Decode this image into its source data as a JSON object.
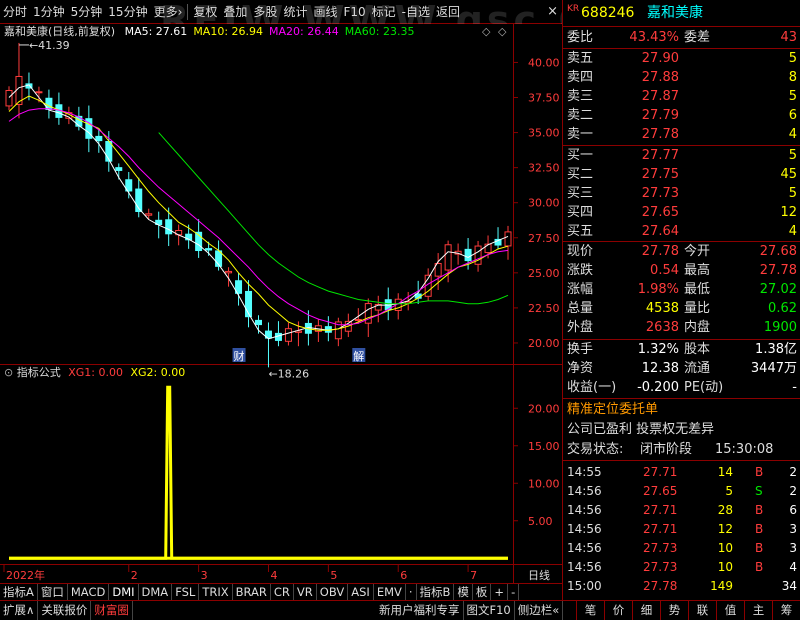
{
  "toolbar": {
    "items": [
      "分时",
      "1分钟",
      "5分钟",
      "15分钟",
      "更多›",
      "复权",
      "叠加",
      "多股",
      "统计",
      "画线",
      "F10",
      "标记",
      "-自选",
      "返回"
    ]
  },
  "watermark": "RFIW.WWW.gsc.CC",
  "chart_title": "嘉和美康(日线,前复权)",
  "ma_legend": [
    {
      "label": "MA5: 27.61",
      "color": "#ffffff"
    },
    {
      "label": "MA10: 26.94",
      "color": "#ffff00"
    },
    {
      "label": "MA20: 26.44",
      "color": "#ff00ff"
    },
    {
      "label": "MA60: 23.35",
      "color": "#00e600"
    }
  ],
  "indicator_legend": {
    "name": "指标公式",
    "xg1": "XG1: 0.00",
    "xg2": "XG2: 0.00"
  },
  "chart_data": [
    {
      "type": "line",
      "title": "嘉和美康(日线,前复权)",
      "y_ticks": [
        "40.00",
        "37.50",
        "35.00",
        "32.50",
        "30.00",
        "27.50",
        "25.00",
        "22.50",
        "20.00"
      ],
      "ylim": [
        18.5,
        41.6
      ],
      "annotations": [
        "41.39",
        "18.26",
        "财",
        "解"
      ],
      "x_labels": [
        "2022年",
        "2",
        "3",
        "4",
        "5",
        "6",
        "7"
      ],
      "series": [
        {
          "name": "MA5",
          "color": "#ffffff",
          "values": [
            37.5,
            38.2,
            38.4,
            37.5,
            36.6,
            36.4,
            36.1,
            35.5,
            35.0,
            34.2,
            33.1,
            31.8,
            30.7,
            29.6,
            28.8,
            28.4,
            28.1,
            27.7,
            27.4,
            27.0,
            26.4,
            25.6,
            24.6,
            23.4,
            22.1,
            20.9,
            20.3,
            20.5,
            20.7,
            20.9,
            21.1,
            21.0,
            20.9,
            21.0,
            21.4,
            21.9,
            22.4,
            22.7,
            22.7,
            22.8,
            23.0,
            23.6,
            24.6,
            25.8,
            26.5,
            26.4,
            26.1,
            26.5,
            27.0,
            27.3,
            27.6
          ]
        },
        {
          "name": "MA10",
          "color": "#ffff00",
          "values": [
            36.5,
            37.2,
            37.6,
            37.3,
            36.9,
            36.6,
            36.3,
            35.9,
            35.6,
            35.3,
            34.4,
            33.5,
            32.6,
            31.7,
            30.8,
            30.0,
            29.3,
            28.6,
            28.2,
            27.7,
            27.1,
            26.6,
            25.9,
            25.0,
            24.2,
            23.5,
            22.7,
            22.1,
            21.5,
            21.2,
            21.0,
            20.9,
            20.9,
            21.0,
            21.2,
            21.5,
            21.8,
            22.0,
            22.3,
            22.5,
            22.8,
            23.2,
            23.7,
            24.3,
            24.9,
            25.4,
            25.6,
            25.9,
            26.3,
            26.7,
            26.9
          ]
        },
        {
          "name": "MA20",
          "color": "#ff00ff",
          "values": [
            35.8,
            36.3,
            36.6,
            36.7,
            36.7,
            36.6,
            36.4,
            36.1,
            35.7,
            35.2,
            34.6,
            34.0,
            33.3,
            32.5,
            31.8,
            31.1,
            30.5,
            29.9,
            29.3,
            28.7,
            28.1,
            27.5,
            26.8,
            26.1,
            25.4,
            24.6,
            23.9,
            23.3,
            22.8,
            22.4,
            22.0,
            21.7,
            21.5,
            21.3,
            21.3,
            21.4,
            21.7,
            22.0,
            22.4,
            22.8,
            23.3,
            23.7,
            24.2,
            24.6,
            25.0,
            25.4,
            25.7,
            26.0,
            26.3,
            26.5,
            26.6
          ]
        },
        {
          "name": "MA60",
          "color": "#00e600",
          "values": [
            null,
            null,
            null,
            null,
            null,
            null,
            null,
            null,
            null,
            null,
            null,
            null,
            null,
            null,
            null,
            35.0,
            34.2,
            33.4,
            32.6,
            31.8,
            31.0,
            30.2,
            29.4,
            28.6,
            27.8,
            27.0,
            26.3,
            25.7,
            25.2,
            24.7,
            24.3,
            24.0,
            23.7,
            23.5,
            23.3,
            23.1,
            23.0,
            22.9,
            22.8,
            22.8,
            22.8,
            22.9,
            23.0,
            23.0,
            23.0,
            22.9,
            22.8,
            22.8,
            22.9,
            23.1,
            23.4
          ]
        }
      ]
    },
    {
      "type": "line",
      "title": "指标公式",
      "y_ticks": [
        "20.00",
        "15.00",
        "10.00",
        "5.00"
      ],
      "ylim": [
        -0.5,
        23.5
      ],
      "series": [
        {
          "name": "XG1",
          "color": "#ffff00",
          "values": [
            0,
            0,
            0,
            0,
            0,
            0,
            0,
            0,
            0,
            0,
            0,
            0,
            0,
            0,
            0,
            0,
            0,
            0,
            0,
            0,
            0,
            0,
            0,
            0,
            0,
            0,
            0,
            0,
            0,
            0,
            0,
            0,
            0,
            0,
            0,
            0,
            0,
            0,
            0,
            0,
            0,
            0,
            0,
            0,
            0,
            0,
            0,
            0,
            0,
            0,
            0
          ]
        },
        {
          "name": "XG2",
          "color": "#ffff00",
          "values": [
            0,
            0,
            0,
            0,
            0,
            0,
            0,
            0,
            0,
            0,
            0,
            0,
            0,
            0,
            0,
            0,
            22.8,
            0,
            0,
            0,
            0,
            0,
            0,
            0,
            0,
            0,
            0,
            0,
            0,
            0,
            0,
            0,
            0,
            0,
            0,
            0,
            0,
            0,
            0,
            0,
            0,
            0,
            0,
            0,
            0,
            0,
            0,
            0,
            0,
            0,
            0
          ]
        }
      ]
    }
  ],
  "bottom_tabs": [
    "指标A",
    "窗口",
    "MACD",
    "DMI",
    "DMA",
    "FSL",
    "TRIX",
    "BRAR",
    "CR",
    "VR",
    "OBV",
    "ASI",
    "EMV",
    "·",
    "指标B",
    "模",
    "板",
    "+",
    "-",
    "日线"
  ],
  "status_bar": {
    "left": [
      {
        "label": "扩展∧",
        "cls": ""
      },
      {
        "label": "关联报价",
        "cls": ""
      },
      {
        "label": "财富圈",
        "cls": "red"
      }
    ],
    "mid": [
      {
        "label": "新用户福利专享",
        "cls": ""
      },
      {
        "label": "图文F10",
        "cls": ""
      },
      {
        "label": "侧边栏«",
        "cls": ""
      }
    ],
    "icons": [
      "笔",
      "价",
      "细",
      "势",
      "联",
      "值",
      "主",
      "筹"
    ]
  },
  "quote": {
    "market": "KR",
    "code": "688246",
    "name": "嘉和美康",
    "weibi_label": "委比",
    "weibi": "43.43%",
    "weicha_label": "委差",
    "weicha": "43",
    "asks": [
      {
        "label": "卖五",
        "price": "27.90",
        "vol": "5"
      },
      {
        "label": "卖四",
        "price": "27.88",
        "vol": "8"
      },
      {
        "label": "卖三",
        "price": "27.87",
        "vol": "5"
      },
      {
        "label": "卖二",
        "price": "27.79",
        "vol": "6"
      },
      {
        "label": "卖一",
        "price": "27.78",
        "vol": "4"
      }
    ],
    "bids": [
      {
        "label": "买一",
        "price": "27.77",
        "vol": "5"
      },
      {
        "label": "买二",
        "price": "27.75",
        "vol": "45"
      },
      {
        "label": "买三",
        "price": "27.73",
        "vol": "5"
      },
      {
        "label": "买四",
        "price": "27.65",
        "vol": "12"
      },
      {
        "label": "买五",
        "price": "27.64",
        "vol": "4"
      }
    ],
    "stats": [
      {
        "l1": "现价",
        "v1": "27.78",
        "c1": "red",
        "l2": "今开",
        "v2": "27.68",
        "c2": "red"
      },
      {
        "l1": "涨跌",
        "v1": "0.54",
        "c1": "red",
        "l2": "最高",
        "v2": "27.78",
        "c2": "red"
      },
      {
        "l1": "涨幅",
        "v1": "1.98%",
        "c1": "red",
        "l2": "最低",
        "v2": "27.02",
        "c2": "green"
      },
      {
        "l1": "总量",
        "v1": "4538",
        "c1": "yellow",
        "l2": "量比",
        "v2": "0.62",
        "c2": "green"
      },
      {
        "l1": "外盘",
        "v1": "2638",
        "c1": "red",
        "l2": "内盘",
        "v2": "1900",
        "c2": "green"
      }
    ],
    "finance": [
      {
        "l1": "换手",
        "v1": "1.32%",
        "l2": "股本",
        "v2": "1.38亿"
      },
      {
        "l1": "净资",
        "v1": "12.38",
        "l2": "流通",
        "v2": "3447万"
      },
      {
        "l1": "收益(一)",
        "v1": "-0.200",
        "l2": "PE(动)",
        "v2": "-"
      }
    ],
    "promo": "精准定位委托单",
    "info1": "公司已盈利 投票权无差异",
    "trade_status_label": "交易状态:",
    "trade_status": "闭市阶段",
    "trade_time": "15:30:08"
  },
  "ticks": [
    {
      "time": "14:55",
      "price": "27.71",
      "vol": "14",
      "side": "B",
      "num": "2"
    },
    {
      "time": "14:56",
      "price": "27.65",
      "vol": "5",
      "side": "S",
      "num": "2"
    },
    {
      "time": "14:56",
      "price": "27.71",
      "vol": "28",
      "side": "B",
      "num": "6"
    },
    {
      "time": "14:56",
      "price": "27.71",
      "vol": "12",
      "side": "B",
      "num": "3"
    },
    {
      "time": "14:56",
      "price": "27.73",
      "vol": "10",
      "side": "B",
      "num": "3"
    },
    {
      "time": "14:56",
      "price": "27.73",
      "vol": "10",
      "side": "B",
      "num": "4"
    },
    {
      "time": "15:00",
      "price": "27.78",
      "vol": "149",
      "side": "",
      "num": "34"
    }
  ],
  "colors": {
    "up": "#ff3c3c",
    "down": "#00e600",
    "frame": "#8b0000",
    "axis_text": "#ff3c3c",
    "candle_down": "#54ffff"
  }
}
